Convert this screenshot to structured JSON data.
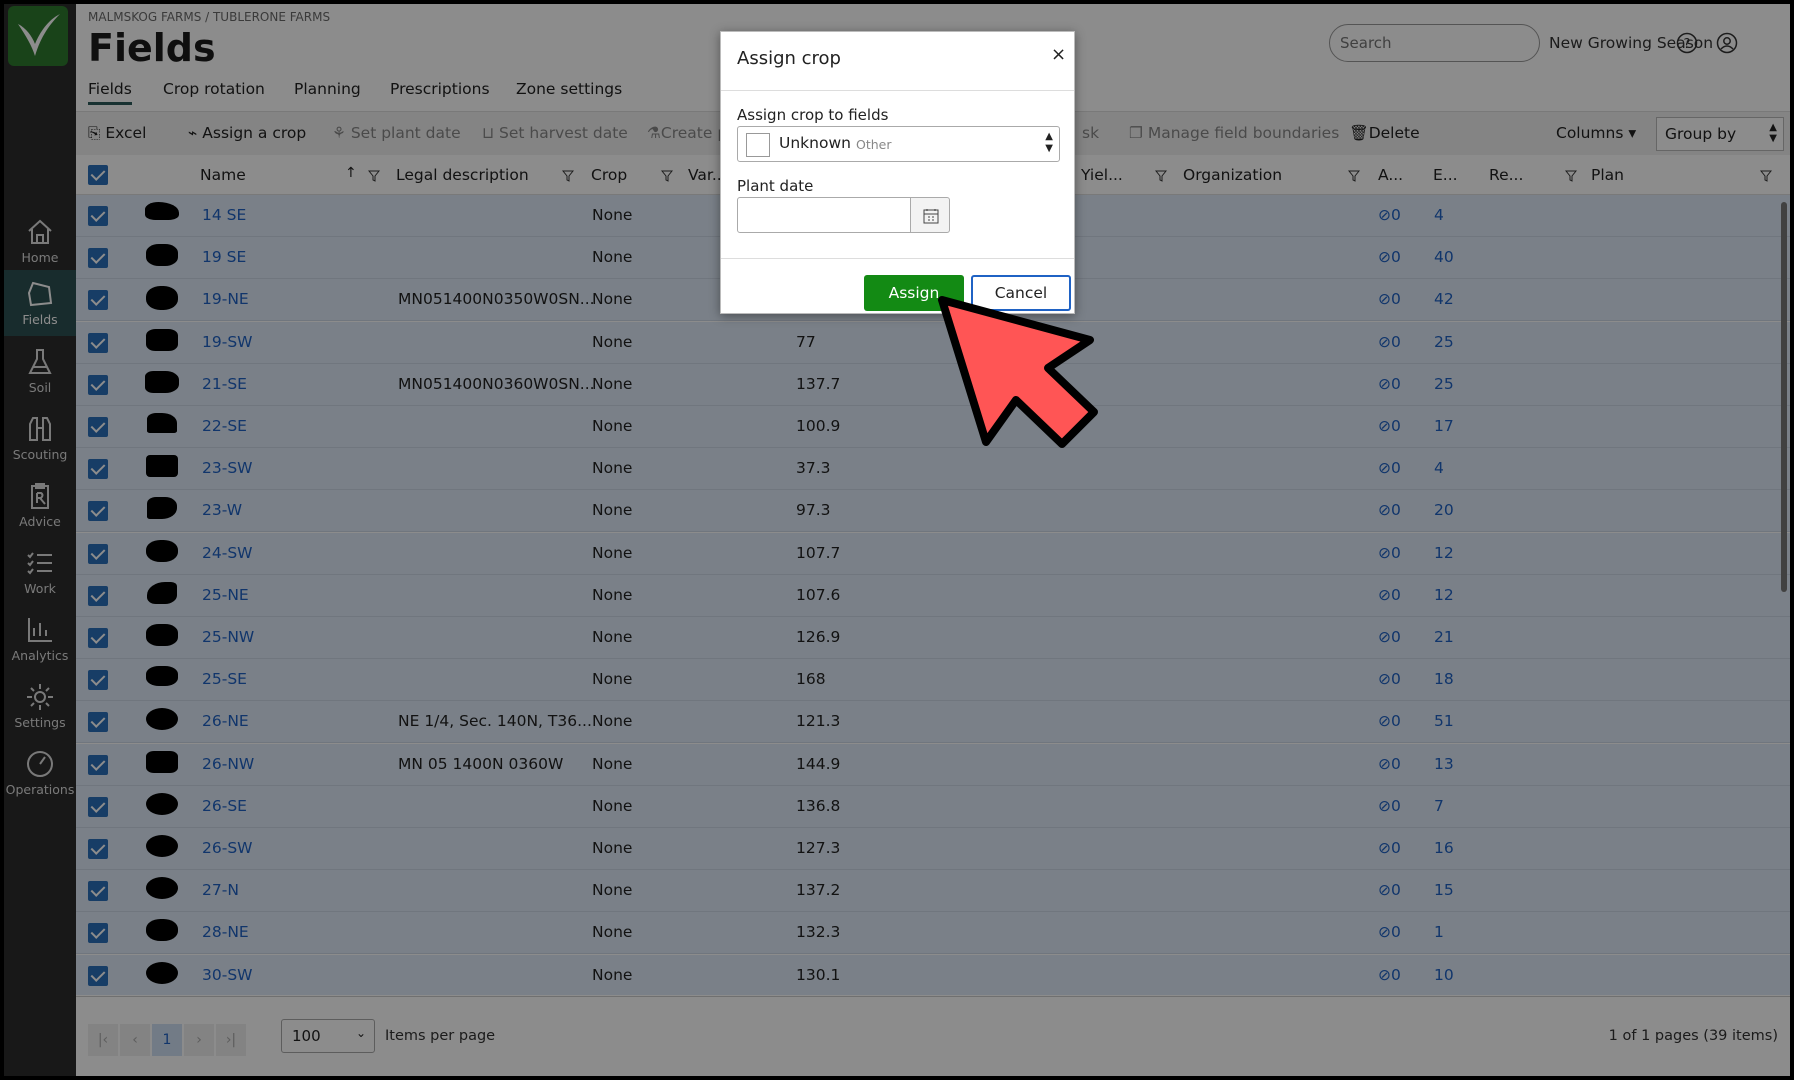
{
  "breadcrumb": "MALMSKOG FARMS / TUBLERONE FARMS",
  "page_title": "Fields",
  "search": {
    "placeholder": "Search"
  },
  "season": "New Growing Season",
  "sidebar": [
    {
      "label": "Home",
      "icon": "home-icon"
    },
    {
      "label": "Fields",
      "icon": "field-icon",
      "active": true
    },
    {
      "label": "Soil",
      "icon": "flask-icon"
    },
    {
      "label": "Scouting",
      "icon": "binoculars-icon"
    },
    {
      "label": "Advice",
      "icon": "clipboard-rx-icon"
    },
    {
      "label": "Work",
      "icon": "checklist-icon"
    },
    {
      "label": "Analytics",
      "icon": "chart-icon"
    },
    {
      "label": "Settings",
      "icon": "gear-icon"
    },
    {
      "label": "Operations",
      "icon": "gauge-icon"
    }
  ],
  "tabs": [
    "Fields",
    "Crop rotation",
    "Planning",
    "Prescriptions",
    "Zone settings"
  ],
  "toolbar": {
    "excel": "Excel",
    "assign_crop": "Assign a crop",
    "set_plant_date": "Set plant date",
    "set_harvest_date": "Set harvest date",
    "create": "Create p",
    "task": "sk",
    "manage_boundaries": "Manage field boundaries",
    "delete": "Delete",
    "columns": "Columns",
    "group_by": "Group by"
  },
  "columns": {
    "name": "Name",
    "legal": "Legal description",
    "crop": "Crop",
    "variety": "Var...",
    "yield": "Yiel...",
    "organization": "Organization",
    "a": "A...",
    "e": "E...",
    "re": "Re...",
    "plan": "Plan"
  },
  "rows": [
    {
      "name": "14 SE",
      "legal": "",
      "crop": "None",
      "area": "",
      "att": "0",
      "e": "4"
    },
    {
      "name": "19 SE",
      "legal": "",
      "crop": "None",
      "area": "",
      "att": "0",
      "e": "40"
    },
    {
      "name": "19-NE",
      "legal": "MN051400N0350W0SN...",
      "crop": "None",
      "area": "",
      "att": "0",
      "e": "42"
    },
    {
      "name": "19-SW",
      "legal": "",
      "crop": "None",
      "area": "77",
      "att": "0",
      "e": "25"
    },
    {
      "name": "21-SE",
      "legal": "MN051400N0360W0SN...",
      "crop": "None",
      "area": "137.7",
      "att": "0",
      "e": "25"
    },
    {
      "name": "22-SE",
      "legal": "",
      "crop": "None",
      "area": "100.9",
      "att": "0",
      "e": "17"
    },
    {
      "name": "23-SW",
      "legal": "",
      "crop": "None",
      "area": "37.3",
      "att": "0",
      "e": "4"
    },
    {
      "name": "23-W",
      "legal": "",
      "crop": "None",
      "area": "97.3",
      "att": "0",
      "e": "20"
    },
    {
      "name": "24-SW",
      "legal": "",
      "crop": "None",
      "area": "107.7",
      "att": "0",
      "e": "12"
    },
    {
      "name": "25-NE",
      "legal": "",
      "crop": "None",
      "area": "107.6",
      "att": "0",
      "e": "12"
    },
    {
      "name": "25-NW",
      "legal": "",
      "crop": "None",
      "area": "126.9",
      "att": "0",
      "e": "21"
    },
    {
      "name": "25-SE",
      "legal": "",
      "crop": "None",
      "area": "168",
      "att": "0",
      "e": "18"
    },
    {
      "name": "26-NE",
      "legal": "NE 1/4, Sec. 140N, T36...",
      "crop": "None",
      "area": "121.3",
      "att": "0",
      "e": "51"
    },
    {
      "name": "26-NW",
      "legal": "MN 05 1400N 0360W",
      "crop": "None",
      "area": "144.9",
      "att": "0",
      "e": "13"
    },
    {
      "name": "26-SE",
      "legal": "",
      "crop": "None",
      "area": "136.8",
      "att": "0",
      "e": "7"
    },
    {
      "name": "26-SW",
      "legal": "",
      "crop": "None",
      "area": "127.3",
      "att": "0",
      "e": "16"
    },
    {
      "name": "27-N",
      "legal": "",
      "crop": "None",
      "area": "137.2",
      "att": "0",
      "e": "15"
    },
    {
      "name": "28-NE",
      "legal": "",
      "crop": "None",
      "area": "132.3",
      "att": "0",
      "e": "1"
    },
    {
      "name": "30-SW",
      "legal": "",
      "crop": "None",
      "area": "130.1",
      "att": "0",
      "e": "10"
    }
  ],
  "pager": {
    "page": "1",
    "page_size": "100",
    "items_per_page": "Items per page",
    "summary": "1 of 1 pages (39 items)"
  },
  "dialog": {
    "title": "Assign crop",
    "close": "×",
    "crop_label": "Assign crop to fields",
    "crop_value": "Unknown",
    "crop_hint": "Other",
    "date_label": "Plant date",
    "plant_date_value": "",
    "assign": "Assign",
    "cancel": "Cancel"
  },
  "colors": {
    "sidebar": "#2c2c2c",
    "sidebar_active": "#2d5052",
    "assign_green": "#138a14",
    "link_blue": "#1f62c4",
    "cursor_red": "#ff5555"
  }
}
